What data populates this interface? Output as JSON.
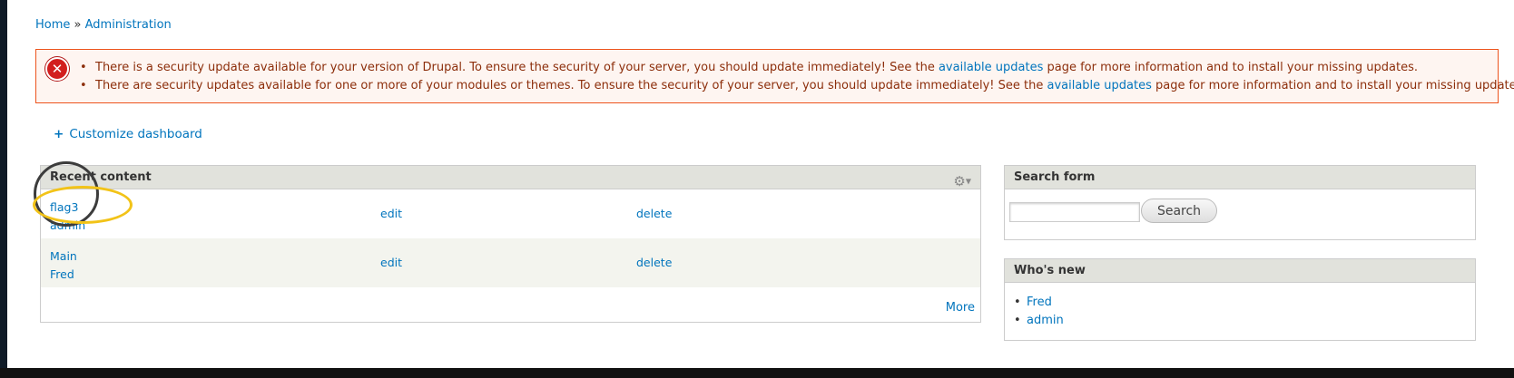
{
  "breadcrumb": {
    "home": "Home",
    "sep": "»",
    "admin": "Administration"
  },
  "messages": {
    "icon": "error-icon",
    "items": [
      {
        "pre": "There is a security update available for your version of Drupal. To ensure the security of your server, you should update immediately! See the ",
        "link": "available updates",
        "post": " page for more information and to install your missing updates."
      },
      {
        "pre": "There are security updates available for one or more of your modules or themes. To ensure the security of your server, you should update immediately! See the ",
        "link": "available updates",
        "post": " page for more information and to install your missing updates."
      }
    ]
  },
  "customize": {
    "icon": "+",
    "label": "Customize dashboard"
  },
  "recent": {
    "title": "Recent content",
    "rows": [
      {
        "title": "flag3",
        "author": "admin",
        "edit": "edit",
        "delete": "delete"
      },
      {
        "title": "Main",
        "author": "Fred",
        "edit": "edit",
        "delete": "delete"
      }
    ],
    "more": "More"
  },
  "search": {
    "title": "Search form",
    "button": "Search",
    "value": ""
  },
  "whosnew": {
    "title": "Who's new",
    "users": [
      "Fred",
      "admin"
    ]
  },
  "colors": {
    "link": "#0074bd",
    "error_border": "#ed541d",
    "error_bg": "#fef5f1",
    "error_text": "#8c2e0b",
    "block_header": "#e1e2dc",
    "annotation_circle": "#3c3c3c",
    "annotation_ellipse": "#f2c318"
  }
}
